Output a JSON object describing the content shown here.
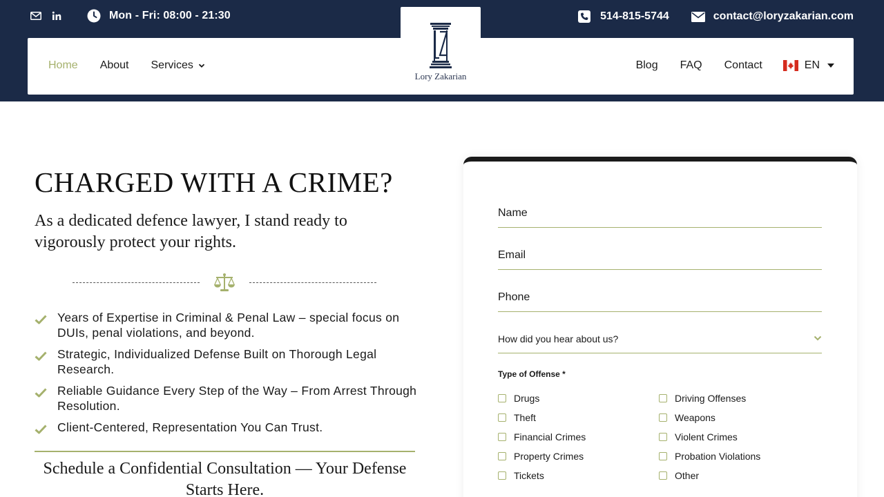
{
  "topbar": {
    "hours": "Mon - Fri: 08:00 - 21:30",
    "phone": "514-815-5744",
    "email": "contact@loryzakarian.com"
  },
  "logo": {
    "name": "Lory Zakarian"
  },
  "nav": {
    "left": [
      {
        "label": "Home",
        "active": true
      },
      {
        "label": "About"
      },
      {
        "label": "Services",
        "has_dropdown": true
      }
    ],
    "right": [
      {
        "label": "Blog"
      },
      {
        "label": "FAQ"
      },
      {
        "label": "Contact"
      }
    ],
    "language": "EN"
  },
  "hero": {
    "title": "CHARGED WITH A CRIME?",
    "subtitle": "As a dedicated defence lawyer, I stand ready to vigorously protect your rights.",
    "features": [
      "Years of Expertise in Criminal & Penal Law – special focus on DUIs, penal violations, and beyond.",
      "Strategic, Individualized Defense Built on Thorough Legal Research.",
      "Reliable Guidance Every Step of the Way – From Arrest Through Resolution.",
      "Client-Centered, Representation You Can Trust."
    ],
    "cta": "Schedule a Confidential Consultation — Your Defense Starts Here."
  },
  "form": {
    "name_label": "Name",
    "email_label": "Email",
    "phone_label": "Phone",
    "source_placeholder": "How did you hear about us?",
    "offense_label": "Type of Offense *",
    "offenses_left": [
      "Drugs",
      "Theft",
      "Financial Crimes",
      "Property Crimes",
      "Tickets"
    ],
    "offenses_right": [
      "Driving Offenses",
      "Weapons",
      "Violent Crimes",
      "Probation Violations",
      "Other"
    ]
  },
  "colors": {
    "navy": "#1b2a47",
    "accent_green": "#a5b16d",
    "text": "#1a1a1a"
  },
  "icons": [
    "mail-icon",
    "linkedin-icon",
    "clock-icon",
    "phone-icon",
    "envelope-icon",
    "chevron-down-icon",
    "canada-flag-icon",
    "caret-down-icon",
    "scales-of-justice-icon",
    "check-icon"
  ]
}
